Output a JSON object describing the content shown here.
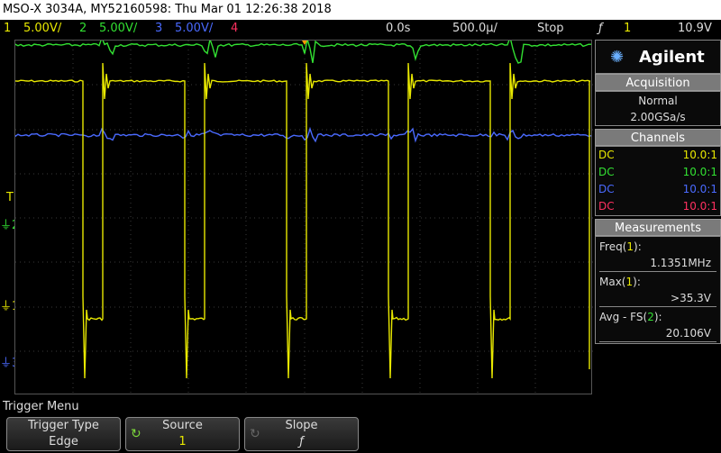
{
  "title_bar": {
    "text": "MSO-X 3034A, MY52160598: Thu Mar 01 12:26:38 2018"
  },
  "status_bar": {
    "ch1": {
      "num": "1",
      "scale": "5.00V/",
      "color": "#e8e800"
    },
    "ch2": {
      "num": "2",
      "scale": "5.00V/",
      "color": "#32e032"
    },
    "ch3": {
      "num": "3",
      "scale": "5.00V/",
      "color": "#4a6aff"
    },
    "ch4": {
      "num": "4",
      "color": "#ff3060"
    },
    "time_delay": "0.0s",
    "time_scale": "500.0µ/",
    "run_state": "Stop",
    "trigger_icon": "ƒ",
    "trigger_channel": "1",
    "trigger_level": "10.9V"
  },
  "plot_markers": {
    "trigger_T": "T",
    "ch2": "2",
    "ch1": "1",
    "ch3": "3"
  },
  "side_panel": {
    "logo_text": "Agilent",
    "acquisition": {
      "header": "Acquisition",
      "mode": "Normal",
      "rate": "2.00GSa/s"
    },
    "channels": {
      "header": "Channels",
      "rows": [
        {
          "coupling": "DC",
          "probe": "10.0:1",
          "color": "#e8e800"
        },
        {
          "coupling": "DC",
          "probe": "10.0:1",
          "color": "#32e032"
        },
        {
          "coupling": "DC",
          "probe": "10.0:1",
          "color": "#4a6aff"
        },
        {
          "coupling": "DC",
          "probe": "10.0:1",
          "color": "#ff3060"
        }
      ]
    },
    "measurements": {
      "header": "Measurements",
      "items": [
        {
          "label_prefix": "Freq(",
          "channel": "1",
          "channel_color": "#e8e800",
          "label_suffix": "):",
          "value": "1.1351MHz"
        },
        {
          "label_prefix": "Max(",
          "channel": "1",
          "channel_color": "#e8e800",
          "label_suffix": "):",
          "value": ">35.3V"
        },
        {
          "label_prefix": "Avg - FS(",
          "channel": "2",
          "channel_color": "#32e032",
          "label_suffix": "):",
          "value": "20.106V"
        }
      ]
    }
  },
  "menu": {
    "title": "Trigger Menu",
    "softkeys": [
      {
        "label": "Trigger Type",
        "value": "Edge"
      },
      {
        "label": "Source",
        "value": "1"
      },
      {
        "label": "Slope",
        "value": "ƒ"
      }
    ]
  }
}
